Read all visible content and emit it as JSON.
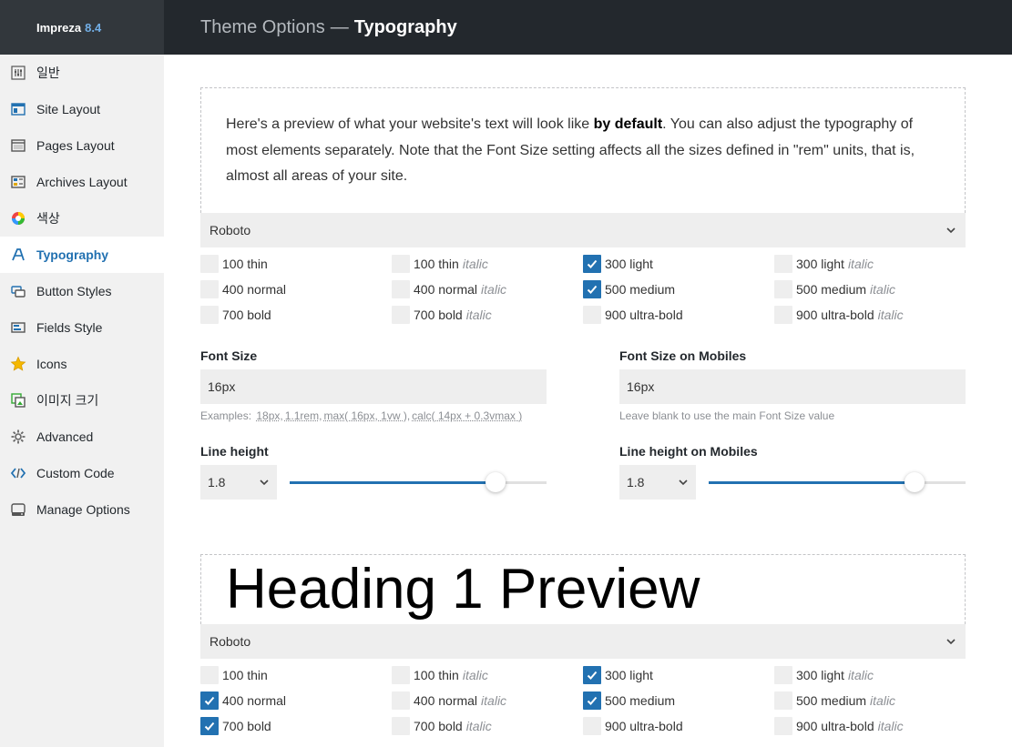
{
  "app": {
    "name": "Impreza",
    "version": "8.4"
  },
  "header": {
    "section": "Theme Options",
    "separator": "—",
    "page": "Typography"
  },
  "sidebar": {
    "items": [
      {
        "label": "일반",
        "icon": "sliders-icon",
        "active": false
      },
      {
        "label": "Site Layout",
        "icon": "site-layout-icon",
        "active": false
      },
      {
        "label": "Pages Layout",
        "icon": "pages-layout-icon",
        "active": false
      },
      {
        "label": "Archives Layout",
        "icon": "archives-layout-icon",
        "active": false
      },
      {
        "label": "색상",
        "icon": "color-wheel-icon",
        "active": false
      },
      {
        "label": "Typography",
        "icon": "typography-icon",
        "active": true
      },
      {
        "label": "Button Styles",
        "icon": "button-styles-icon",
        "active": false
      },
      {
        "label": "Fields Style",
        "icon": "fields-style-icon",
        "active": false
      },
      {
        "label": "Icons",
        "icon": "star-icon",
        "active": false
      },
      {
        "label": "이미지 크기",
        "icon": "image-sizes-icon",
        "active": false
      },
      {
        "label": "Advanced",
        "icon": "gear-icon",
        "active": false
      },
      {
        "label": "Custom Code",
        "icon": "code-icon",
        "active": false
      },
      {
        "label": "Manage Options",
        "icon": "hard-drive-icon",
        "active": false
      }
    ]
  },
  "body_font": {
    "preview": {
      "text_before": "Here's a preview of what your website's text will look like ",
      "text_bold": "by default",
      "text_after": ". You can also adjust the typography of most elements separately. Note that the Font Size setting affects all the sizes defined in \"rem\" units, that is, almost all areas of your site."
    },
    "font_family": "Roboto",
    "weights": [
      {
        "label": "100 thin",
        "italic": "",
        "checked": false
      },
      {
        "label": "100 thin",
        "italic": "italic",
        "checked": false
      },
      {
        "label": "300 light",
        "italic": "",
        "checked": true
      },
      {
        "label": "300 light",
        "italic": "italic",
        "checked": false
      },
      {
        "label": "400 normal",
        "italic": "",
        "checked": false
      },
      {
        "label": "400 normal",
        "italic": "italic",
        "checked": false
      },
      {
        "label": "500 medium",
        "italic": "",
        "checked": true
      },
      {
        "label": "500 medium",
        "italic": "italic",
        "checked": false
      },
      {
        "label": "700 bold",
        "italic": "",
        "checked": false
      },
      {
        "label": "700 bold",
        "italic": "italic",
        "checked": false
      },
      {
        "label": "900 ultra-bold",
        "italic": "",
        "checked": false
      },
      {
        "label": "900 ultra-bold",
        "italic": "italic",
        "checked": false
      }
    ],
    "font_size": {
      "label": "Font Size",
      "value": "16px",
      "hint_prefix": "Examples:",
      "examples": [
        "18px",
        "1.1rem",
        "max( 16px, 1vw )",
        "calc( 14px + 0.3vmax )"
      ]
    },
    "font_size_mobiles": {
      "label": "Font Size on Mobiles",
      "value": "16px",
      "hint": "Leave blank to use the main Font Size value"
    },
    "line_height": {
      "label": "Line height",
      "value": "1.8",
      "level_percent": 80
    },
    "line_height_mobiles": {
      "label": "Line height on Mobiles",
      "value": "1.8",
      "level_percent": 80
    }
  },
  "heading1": {
    "preview": "Heading 1 Preview",
    "font_family": "Roboto",
    "weights": [
      {
        "label": "100 thin",
        "italic": "",
        "checked": false
      },
      {
        "label": "100 thin",
        "italic": "italic",
        "checked": false
      },
      {
        "label": "300 light",
        "italic": "",
        "checked": true
      },
      {
        "label": "300 light",
        "italic": "italic",
        "checked": false
      },
      {
        "label": "400 normal",
        "italic": "",
        "checked": true
      },
      {
        "label": "400 normal",
        "italic": "italic",
        "checked": false
      },
      {
        "label": "500 medium",
        "italic": "",
        "checked": true
      },
      {
        "label": "500 medium",
        "italic": "italic",
        "checked": false
      },
      {
        "label": "700 bold",
        "italic": "",
        "checked": true
      },
      {
        "label": "700 bold",
        "italic": "italic",
        "checked": false
      },
      {
        "label": "900 ultra-bold",
        "italic": "",
        "checked": false
      },
      {
        "label": "900 ultra-bold",
        "italic": "italic",
        "checked": false
      }
    ]
  },
  "colors": {
    "accent": "#2271b1",
    "sidebar_bg": "#f1f1f1",
    "header_bg": "#23282d",
    "version": "#72aee6"
  }
}
